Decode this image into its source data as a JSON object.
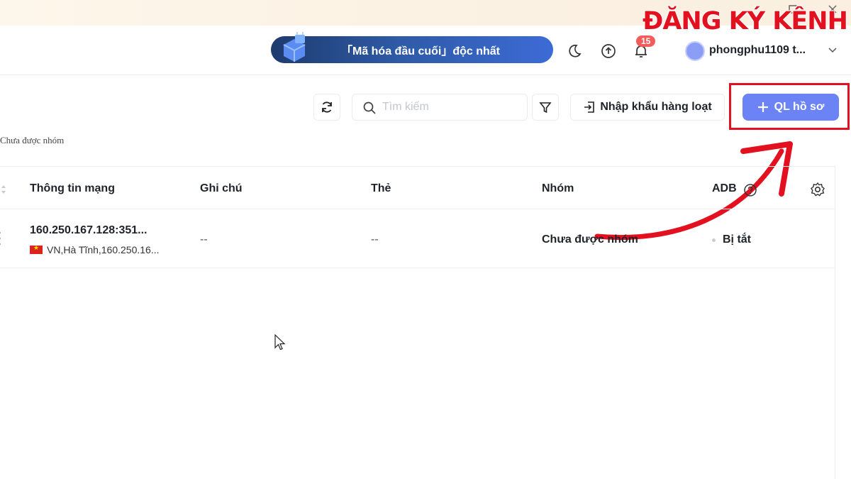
{
  "promo": {
    "text": "「Mã hóa đầu cuối」độc nhất"
  },
  "notifications": {
    "count": "15"
  },
  "user": {
    "name": "phongphu1109 t..."
  },
  "toolbar": {
    "search_placeholder": "Tìm kiếm",
    "import_label": "Nhập khẩu hàng loạt",
    "primary_label": "QL hồ sơ"
  },
  "group_filter": {
    "label": "Chưa được nhóm"
  },
  "table": {
    "columns": [
      "Thông tin mạng",
      "Ghi chú",
      "Thẻ",
      "Nhóm",
      "ADB"
    ],
    "rows": [
      {
        "network": "160.250.167.128:351...",
        "location": "VN,Hà Tĩnh,160.250.16...",
        "note": "--",
        "tag": "--",
        "group": "Chưa được nhóm",
        "adb": "Bị tắt"
      }
    ]
  },
  "overlay": {
    "brand_text": "ĐĂNG KÝ KÊNH"
  },
  "colors": {
    "accent": "#6b83f5",
    "highlight": "#e3101f",
    "badge": "#f45b5b",
    "promo_start": "#1e3b6e",
    "promo_end": "#3d6bd6"
  },
  "icons": {
    "window": [
      "maximize-icon",
      "close-icon"
    ],
    "header": [
      "moon-icon",
      "upload-icon",
      "bell-icon",
      "chevron-down-icon"
    ],
    "toolbar": [
      "refresh-icon",
      "search-icon",
      "filter-icon",
      "import-icon",
      "plus-icon"
    ],
    "table": [
      "sort-icon",
      "help-icon",
      "settings-icon",
      "more-icon",
      "flag-vn-icon"
    ]
  }
}
